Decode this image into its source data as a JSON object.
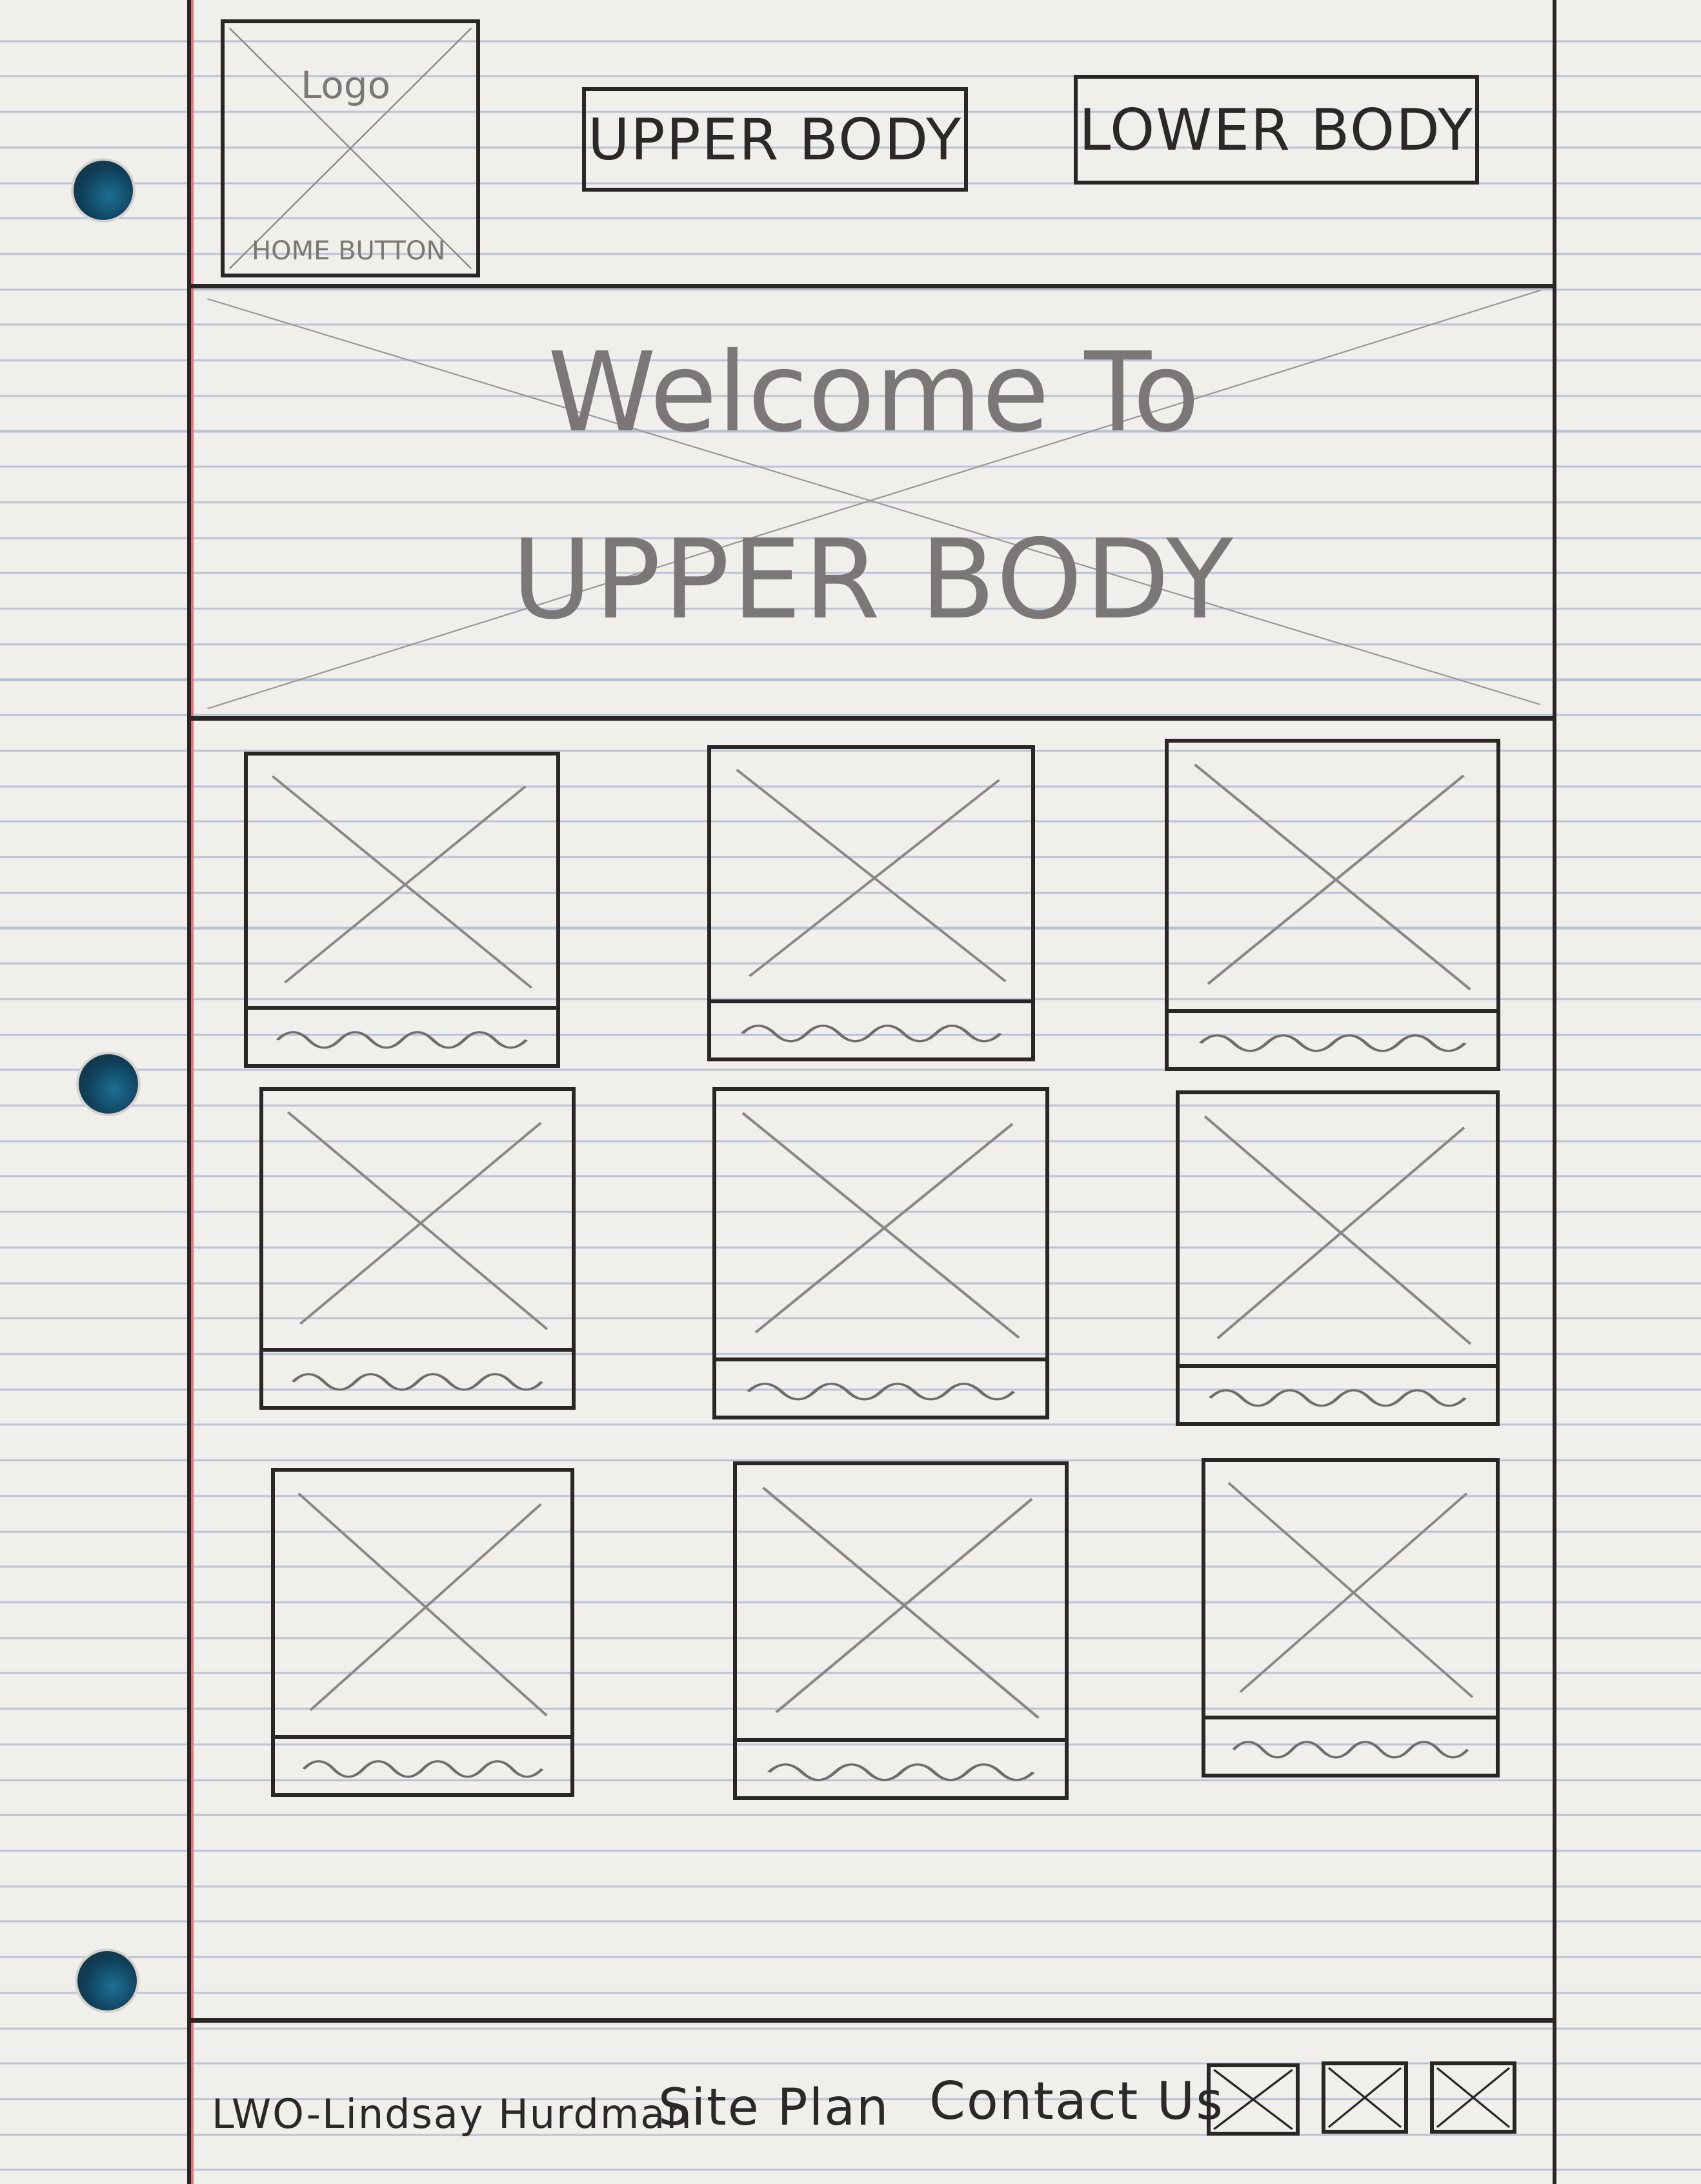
{
  "header": {
    "logo_label": "Logo",
    "home_label": "HOME BUTTON",
    "nav": [
      "UPPER BODY",
      "LOWER BODY"
    ]
  },
  "hero": {
    "line1": "Welcome To",
    "line2": "UPPER BODY"
  },
  "grid": {
    "cards": [
      {
        "id": "1"
      },
      {
        "id": "2"
      },
      {
        "id": "3"
      },
      {
        "id": "4"
      },
      {
        "id": "5"
      },
      {
        "id": "6"
      },
      {
        "id": "7"
      },
      {
        "id": "8"
      },
      {
        "id": "9"
      }
    ]
  },
  "footer": {
    "credit": "LWO-Lindsay Hurdman",
    "site_plan": "Site Plan",
    "contact": "Contact Us",
    "social_icons": [
      "social-icon-1",
      "social-icon-2",
      "social-icon-3"
    ]
  },
  "colors": {
    "ink": "#2a2626",
    "pencil": "#7a7776",
    "paper": "#f1efec",
    "rule": "#b9c1d6",
    "margin": "#e3747c"
  }
}
